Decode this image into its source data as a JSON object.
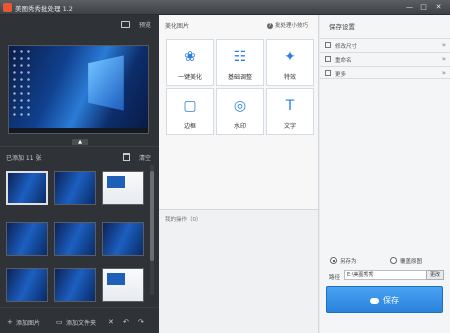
{
  "window": {
    "title": "美图秀秀批处理 1.2",
    "controls": {
      "minimize": "—",
      "maximize": "□",
      "close": "✕"
    }
  },
  "left": {
    "preview_label": "预览",
    "list_count": "已添加 11 张",
    "clear_label": "清空",
    "add_image": "添加图片",
    "add_folder": "添加文件夹",
    "thumbnails": [
      {
        "style": "blue",
        "selected": true
      },
      {
        "style": "blue",
        "selected": false
      },
      {
        "style": "light",
        "selected": false
      },
      {
        "style": "blue",
        "selected": false
      },
      {
        "style": "blue",
        "selected": false
      },
      {
        "style": "blue",
        "selected": false
      },
      {
        "style": "blue",
        "selected": false
      },
      {
        "style": "blue",
        "selected": false
      },
      {
        "style": "light",
        "selected": false
      }
    ]
  },
  "center": {
    "header": "美化图片",
    "tip": "批处理小技巧",
    "tools": [
      {
        "label": "一键美化",
        "icon": "tulip-icon"
      },
      {
        "label": "基础调整",
        "icon": "sliders-icon"
      },
      {
        "label": "特效",
        "icon": "magic-wand-icon"
      },
      {
        "label": "边框",
        "icon": "frame-icon"
      },
      {
        "label": "水印",
        "icon": "watermark-icon"
      },
      {
        "label": "文字",
        "icon": "text-icon"
      }
    ],
    "ops_label": "我的操作（0）"
  },
  "right": {
    "header": "保存设置",
    "options": [
      "修改尺寸",
      "重命名",
      "更多"
    ],
    "save_as": "另存为",
    "overwrite": "覆盖原图",
    "path_label": "路径",
    "path_value": "E:\\美图秀秀",
    "browse": "更改",
    "save": "保存"
  }
}
